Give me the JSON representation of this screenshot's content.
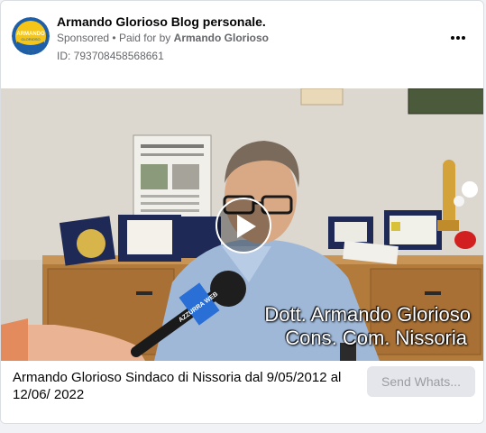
{
  "ad": {
    "page_name": "Armando Glorioso Blog personale.",
    "sponsored": "Sponsored",
    "separator": "•",
    "paid_for_by_prefix": "Paid for by",
    "paid_for_by_name": "Armando Glorioso",
    "library_id": "ID: 793708458568661",
    "avatar_label": "ARMANDO",
    "avatar_sublabel": "GLORIOSO",
    "more_icon": "more-horizontal-icon"
  },
  "video": {
    "overlay_line_1": "Dott. Armando Glorioso",
    "overlay_line_2": "Cons. Com. Nissoria",
    "mic_label": "AZZURRA WEB",
    "play_icon": "play-icon"
  },
  "footer": {
    "caption": "Armando Glorioso Sindaco di Nissoria dal 9/05/2012 al 12/06/ 2022",
    "cta_label": "Send Whats..."
  },
  "colors": {
    "avatar_bg": "#f5c518",
    "avatar_ring": "#1f5fa8",
    "cta_bg": "#e4e6eb"
  }
}
